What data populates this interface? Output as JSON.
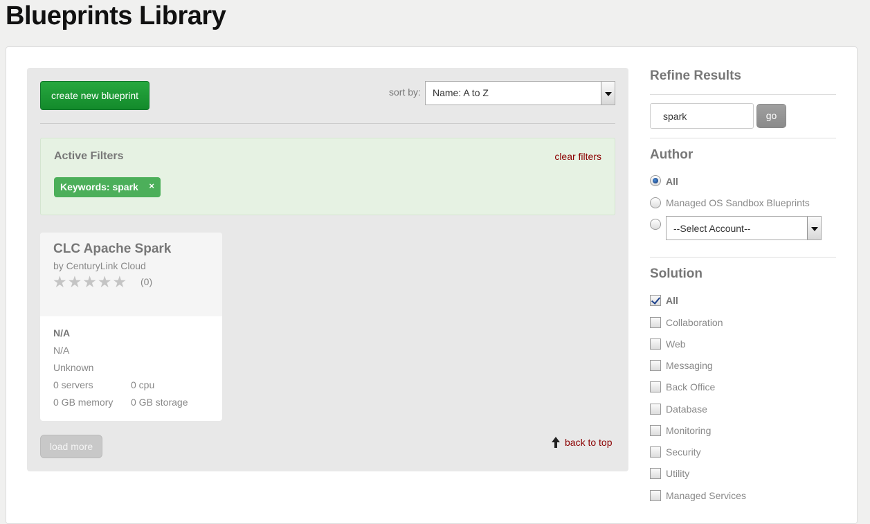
{
  "page": {
    "title": "Blueprints Library"
  },
  "toolbar": {
    "create_label": "create new blueprint",
    "sort_label": "sort by:",
    "sort_value": "Name: A to Z"
  },
  "filters": {
    "title": "Active Filters",
    "clear_label": "clear filters",
    "tag_label": "Keywords: spark",
    "tag_remove": "×"
  },
  "card": {
    "title": "CLC Apache Spark",
    "author": "by CenturyLink Cloud",
    "stars": "★★★★★",
    "rating_count": "(0)",
    "line1": "N/A",
    "line2": "N/A",
    "line3": "Unknown",
    "servers": "0 servers",
    "cpu": "0 cpu",
    "memory": "0 GB memory",
    "storage": "0 GB storage"
  },
  "footer": {
    "load_more": "load more",
    "back_to_top": "back to top"
  },
  "sidebar": {
    "refine_title": "Refine Results",
    "search_value": "spark",
    "go_label": "go",
    "author_title": "Author",
    "author_options": {
      "all": "All",
      "managed": "Managed OS Sandbox Blueprints",
      "account": "--Select Account--"
    },
    "solution_title": "Solution",
    "solutions": [
      "All",
      "Collaboration",
      "Web",
      "Messaging",
      "Back Office",
      "Database",
      "Monitoring",
      "Security",
      "Utility",
      "Managed Services"
    ]
  }
}
